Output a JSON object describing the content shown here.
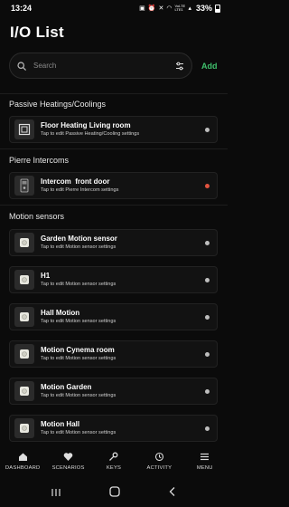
{
  "status_bar": {
    "time": "13:24",
    "network_label": "VoLTE LTE1",
    "battery": "33%"
  },
  "page": {
    "title": "I/O List"
  },
  "search": {
    "placeholder": "Search",
    "add_label": "Add"
  },
  "sections": [
    {
      "title": "Passive Heatings/Coolings",
      "items": [
        {
          "title": "Floor Heating Living room",
          "subtitle": "Tap to edit Passive Heating/Cooling settings",
          "icon": "floor-heating-icon",
          "status_color": "#bdbdbd"
        }
      ]
    },
    {
      "title": "Pierre Intercoms",
      "items": [
        {
          "title": "Intercom  front door",
          "subtitle": "Tap to edit Pierre Intercom settings",
          "icon": "intercom-icon",
          "status_color": "#e0533f"
        }
      ]
    },
    {
      "title": "Motion sensors",
      "items": [
        {
          "title": "Garden Motion sensor",
          "subtitle": "Tap to edit Motion sensor settings",
          "icon": "motion-sensor-icon",
          "status_color": "#bdbdbd"
        },
        {
          "title": "H1",
          "subtitle": "Tap to edit Motion sensor settings",
          "icon": "motion-sensor-icon",
          "status_color": "#bdbdbd"
        },
        {
          "title": "Hall Motion",
          "subtitle": "Tap to edit Motion sensor settings",
          "icon": "motion-sensor-icon",
          "status_color": "#bdbdbd"
        },
        {
          "title": "Motion Cynema room",
          "subtitle": "Tap to edit Motion sensor settings",
          "icon": "motion-sensor-icon",
          "status_color": "#bdbdbd"
        },
        {
          "title": "Motion Garden",
          "subtitle": "Tap to edit Motion sensor settings",
          "icon": "motion-sensor-icon",
          "status_color": "#bdbdbd"
        },
        {
          "title": "Motion Hall",
          "subtitle": "Tap to edit Motion sensor settings",
          "icon": "motion-sensor-icon",
          "status_color": "#bdbdbd"
        }
      ]
    }
  ],
  "tabs": [
    {
      "label": "DASHBOARD",
      "icon": "home-icon"
    },
    {
      "label": "SCENARIOS",
      "icon": "heart-icon"
    },
    {
      "label": "KEYS",
      "icon": "key-icon"
    },
    {
      "label": "ACTIVITY",
      "icon": "history-icon"
    },
    {
      "label": "MENU",
      "icon": "menu-icon"
    }
  ],
  "colors": {
    "accent": "#3fc06c",
    "background": "#0b0b0b",
    "card": "#121212",
    "status_alert": "#e0533f",
    "status_idle": "#bdbdbd"
  }
}
